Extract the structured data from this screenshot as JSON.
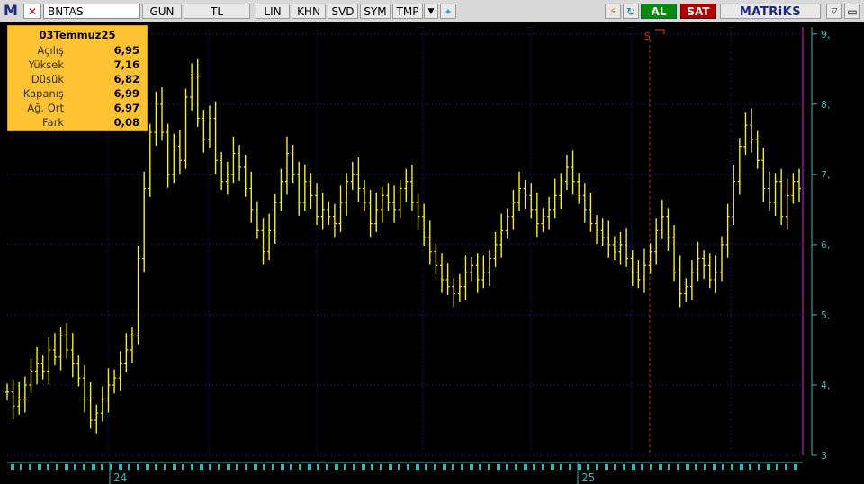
{
  "toolbar": {
    "logo": "M",
    "symbol": "BNTAS",
    "buttons": [
      "GUN",
      "TL",
      "LIN",
      "KHN",
      "SVD",
      "SYM",
      "TMP"
    ],
    "al_label": "AL",
    "sat_label": "SAT",
    "brand": "MATRiKS"
  },
  "info": {
    "date": "03Temmuz25",
    "rows": [
      {
        "label": "Açılış",
        "value": "6,95"
      },
      {
        "label": "Yüksek",
        "value": "7,16"
      },
      {
        "label": "Düşük",
        "value": "6,82"
      },
      {
        "label": "Kapanış",
        "value": "6,99"
      },
      {
        "label": "Ağ. Ort",
        "value": "6,97"
      },
      {
        "label": "Fark",
        "value": "0,08"
      }
    ]
  },
  "chart_data": {
    "type": "bar",
    "y_axis_labels": [
      "3",
      "4,",
      "5,",
      "6,",
      "7,",
      "8,",
      "9,"
    ],
    "ylim": [
      3,
      9.1
    ],
    "x_axis_labels": [
      "24",
      "25"
    ],
    "signal_marker": "S",
    "grid": true,
    "colors": {
      "bars": "#f5ee2a",
      "grid": "#1a2bbf",
      "axis": "#2fb8b8",
      "signal": "#e02020",
      "highlight": "#b020b0"
    },
    "series": [
      {
        "values": [
          3.9,
          3.7,
          3.8,
          4.0,
          4.2,
          4.3,
          4.2,
          4.5,
          4.4,
          4.7,
          4.5,
          4.3,
          4.1,
          3.8,
          3.5,
          3.6,
          3.8,
          4.0,
          4.1,
          4.3,
          4.5,
          4.7,
          5.8,
          6.8,
          7.6,
          8.0,
          7.6,
          7.0,
          7.4,
          7.2,
          8.1,
          8.4,
          7.8,
          7.5,
          7.8,
          7.2,
          6.9,
          7.0,
          7.3,
          7.1,
          6.8,
          6.5,
          6.2,
          5.9,
          6.2,
          6.6,
          6.9,
          7.3,
          7.0,
          6.6,
          6.9,
          6.7,
          6.4,
          6.5,
          6.4,
          6.3,
          6.6,
          6.9,
          7.0,
          6.8,
          6.6,
          6.3,
          6.5,
          6.7,
          6.6,
          6.5,
          6.8,
          6.9,
          6.6,
          6.4,
          6.1,
          5.9,
          5.7,
          5.5,
          5.4,
          5.3,
          5.4,
          5.6,
          5.7,
          5.5,
          5.6,
          5.8,
          6.0,
          6.2,
          6.4,
          6.6,
          6.8,
          6.7,
          6.5,
          6.3,
          6.4,
          6.5,
          6.7,
          6.9,
          7.1,
          6.9,
          6.7,
          6.5,
          6.3,
          6.2,
          6.1,
          6.0,
          5.9,
          6.0,
          5.8,
          5.6,
          5.5,
          5.7,
          5.9,
          6.2,
          6.4,
          6.1,
          5.6,
          5.3,
          5.4,
          5.6,
          5.8,
          5.7,
          5.5,
          5.6,
          6.0,
          6.4,
          6.9,
          7.4,
          7.7,
          7.5,
          7.2,
          6.8,
          6.6,
          6.9,
          6.4,
          6.7,
          6.9,
          6.8
        ]
      }
    ]
  }
}
